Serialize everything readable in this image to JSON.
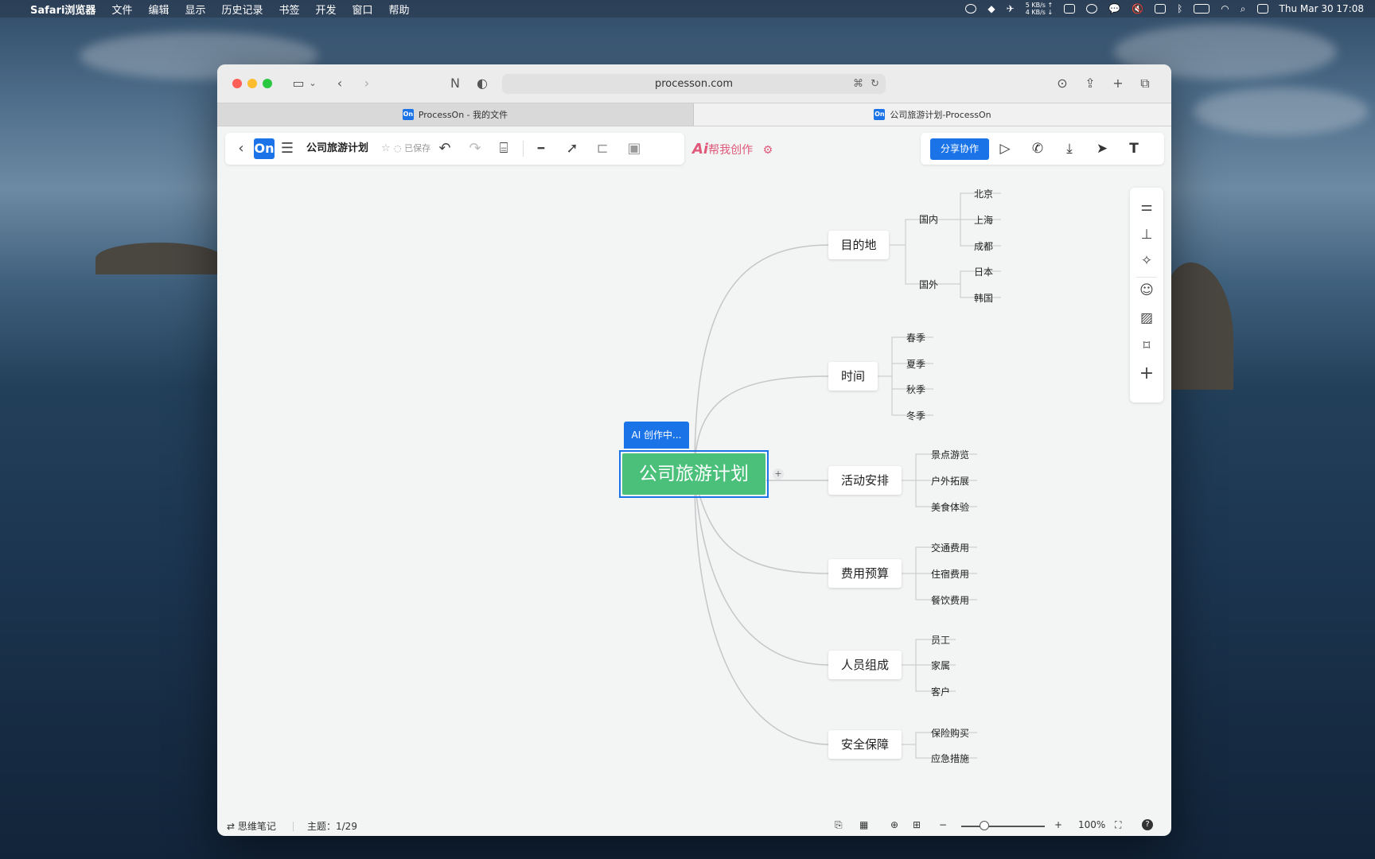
{
  "menubar": {
    "app_name": "Safari浏览器",
    "items": [
      "文件",
      "编辑",
      "显示",
      "历史记录",
      "书签",
      "开发",
      "窗口",
      "帮助"
    ],
    "net_speed": "5 KB/s ↑\n4 KB/s ↓",
    "datetime": "Thu Mar 30  17:08"
  },
  "browser": {
    "url": "processon.com",
    "tabs": [
      {
        "label": "ProcessOn - 我的文件",
        "favicon": "On"
      },
      {
        "label": "公司旅游计划-ProcessOn",
        "favicon": "On"
      }
    ]
  },
  "app": {
    "logo": "On",
    "doc_title": "公司旅游计划",
    "save_status": "已保存",
    "ai_prefix": "Ai",
    "ai_help": "帮我创作",
    "share_label": "分享协作",
    "accent_color": "#1a74e8",
    "center_color": "#4bc07a"
  },
  "mindmap": {
    "ai_badge": "AI 创作中...",
    "center": "公司旅游计划",
    "branches": [
      {
        "label": "目的地",
        "groups": [
          {
            "label": "国内",
            "leaves": [
              "北京",
              "上海",
              "成都"
            ]
          },
          {
            "label": "国外",
            "leaves": [
              "日本",
              "韩国"
            ]
          }
        ]
      },
      {
        "label": "时间",
        "leaves": [
          "春季",
          "夏季",
          "秋季",
          "冬季"
        ]
      },
      {
        "label": "活动安排",
        "leaves": [
          "景点游览",
          "户外拓展",
          "美食体验"
        ]
      },
      {
        "label": "费用预算",
        "leaves": [
          "交通费用",
          "住宿费用",
          "餐饮费用"
        ]
      },
      {
        "label": "人员组成",
        "leaves": [
          "员工",
          "家属",
          "客户"
        ]
      },
      {
        "label": "安全保障",
        "leaves": [
          "保险购买",
          "应急措施"
        ]
      }
    ]
  },
  "statusbar": {
    "mode": "⇄ 思维笔记",
    "topic_count": "主题：1/29",
    "zoom": "100%"
  }
}
